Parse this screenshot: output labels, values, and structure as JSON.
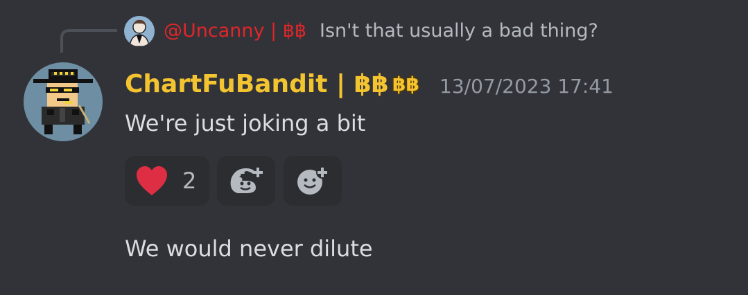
{
  "reply": {
    "username": "@Uncanny | ฿฿",
    "text": "Isn't that usually a bad thing?",
    "avatar_icon": "user-avatar-icon"
  },
  "message": {
    "username": "ChartFuBandit | ฿฿",
    "role_badge": "฿฿",
    "timestamp": "13/07/2023 17:41",
    "avatar_icon": "bandit-pixel-avatar-icon",
    "lines": [
      "We're just joking a bit",
      "We would never dilute"
    ]
  },
  "reactions": [
    {
      "icon": "heart-icon",
      "count": "2",
      "color": "#dd2e44"
    },
    {
      "icon": "add-super-reaction-icon"
    },
    {
      "icon": "add-reaction-icon"
    }
  ],
  "colors": {
    "background": "#313338",
    "reply_username": "#e0262a",
    "username": "#f4c430",
    "timestamp": "#949ba4",
    "text": "#dbdee1",
    "reaction_bg": "#2b2d31"
  }
}
